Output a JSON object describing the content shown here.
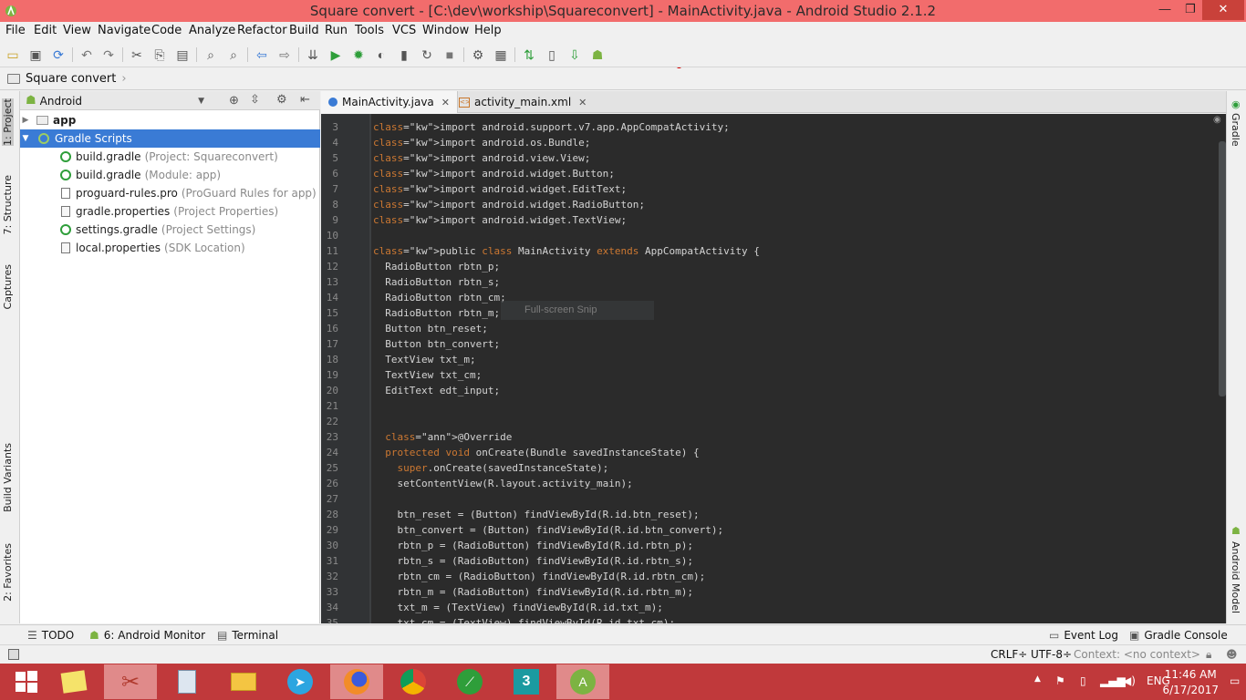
{
  "window": {
    "title": "Square convert - [C:\\dev\\workship\\Squareconvert] - MainActivity.java - Android Studio 2.1.2",
    "minimize": "—",
    "maximize": "❐",
    "close": "✕"
  },
  "menu": [
    "File",
    "Edit",
    "View",
    "Navigate",
    "Code",
    "Analyze",
    "Refactor",
    "Build",
    "Run",
    "Tools",
    "VCS",
    "Window",
    "Help"
  ],
  "breadcrumb": "Square convert",
  "left_tool_tabs": [
    "1: Project",
    "7: Structure",
    "Captures",
    "Build Variants",
    "2: Favorites"
  ],
  "right_tool_tabs": [
    "Gradle",
    "Android Model"
  ],
  "project_panel": {
    "view_selector": "Android",
    "tree": [
      {
        "label": "app",
        "hint": "",
        "bold": true
      },
      {
        "label": "Gradle Scripts",
        "hint": "",
        "selected": true
      },
      {
        "label": "build.gradle",
        "hint": "(Project: Squareconvert)"
      },
      {
        "label": "build.gradle",
        "hint": "(Module: app)"
      },
      {
        "label": "proguard-rules.pro",
        "hint": "(ProGuard Rules for app)"
      },
      {
        "label": "gradle.properties",
        "hint": "(Project Properties)"
      },
      {
        "label": "settings.gradle",
        "hint": "(Project Settings)"
      },
      {
        "label": "local.properties",
        "hint": "(SDK Location)"
      }
    ]
  },
  "editor_tabs": [
    {
      "label": "MainActivity.java",
      "active": true
    },
    {
      "label": "activity_main.xml",
      "active": false
    }
  ],
  "code_lines": [
    {
      "n": "3",
      "t": "import android.support.v7.app.AppCompatActivity;"
    },
    {
      "n": "4",
      "t": "import android.os.Bundle;"
    },
    {
      "n": "5",
      "t": "import android.view.View;"
    },
    {
      "n": "6",
      "t": "import android.widget.Button;"
    },
    {
      "n": "7",
      "t": "import android.widget.EditText;"
    },
    {
      "n": "8",
      "t": "import android.widget.RadioButton;"
    },
    {
      "n": "9",
      "t": "import android.widget.TextView;"
    },
    {
      "n": "10",
      "t": ""
    },
    {
      "n": "11",
      "t": "public class MainActivity extends AppCompatActivity {"
    },
    {
      "n": "12",
      "t": "  RadioButton rbtn_p;"
    },
    {
      "n": "13",
      "t": "  RadioButton rbtn_s;"
    },
    {
      "n": "14",
      "t": "  RadioButton rbtn_cm;"
    },
    {
      "n": "15",
      "t": "  RadioButton rbtn_m;"
    },
    {
      "n": "16",
      "t": "  Button btn_reset;"
    },
    {
      "n": "17",
      "t": "  Button btn_convert;"
    },
    {
      "n": "18",
      "t": "  TextView txt_m;"
    },
    {
      "n": "19",
      "t": "  TextView txt_cm;"
    },
    {
      "n": "20",
      "t": "  EditText edt_input;"
    },
    {
      "n": "21",
      "t": ""
    },
    {
      "n": "22",
      "t": ""
    },
    {
      "n": "23",
      "t": "  @Override"
    },
    {
      "n": "24",
      "t": "  protected void onCreate(Bundle savedInstanceState) {"
    },
    {
      "n": "25",
      "t": "    super.onCreate(savedInstanceState);"
    },
    {
      "n": "26",
      "t": "    setContentView(R.layout.activity_main);"
    },
    {
      "n": "27",
      "t": ""
    },
    {
      "n": "28",
      "t": "    btn_reset = (Button) findViewById(R.id.btn_reset);"
    },
    {
      "n": "29",
      "t": "    btn_convert = (Button) findViewById(R.id.btn_convert);"
    },
    {
      "n": "30",
      "t": "    rbtn_p = (RadioButton) findViewById(R.id.rbtn_p);"
    },
    {
      "n": "31",
      "t": "    rbtn_s = (RadioButton) findViewById(R.id.rbtn_s);"
    },
    {
      "n": "32",
      "t": "    rbtn_cm = (RadioButton) findViewById(R.id.rbtn_cm);"
    },
    {
      "n": "33",
      "t": "    rbtn_m = (RadioButton) findViewById(R.id.rbtn_m);"
    },
    {
      "n": "34",
      "t": "    txt_m = (TextView) findViewById(R.id.txt_m);"
    },
    {
      "n": "35",
      "t": "    txt_cm = (TextView) findViewById(R.id.txt_cm);"
    }
  ],
  "snip_overlay": "Full-screen Snip",
  "bottom_tabs": [
    "TODO",
    "6: Android Monitor",
    "Terminal"
  ],
  "bottom_right_tabs": [
    "Event Log",
    "Gradle Console"
  ],
  "status": {
    "line_sep": "CRLF÷",
    "encoding": "UTF-8÷",
    "context": "Context: <no context>"
  },
  "taskbar": {
    "language": "ENG",
    "time": "11:46 AM",
    "date": "6/17/2017"
  },
  "colors": {
    "titlebar": "#f26c6c",
    "taskbar": "#c0393b",
    "editor_bg": "#2b2b2b",
    "keyword": "#cc7832",
    "selection": "#3a7bd5"
  }
}
